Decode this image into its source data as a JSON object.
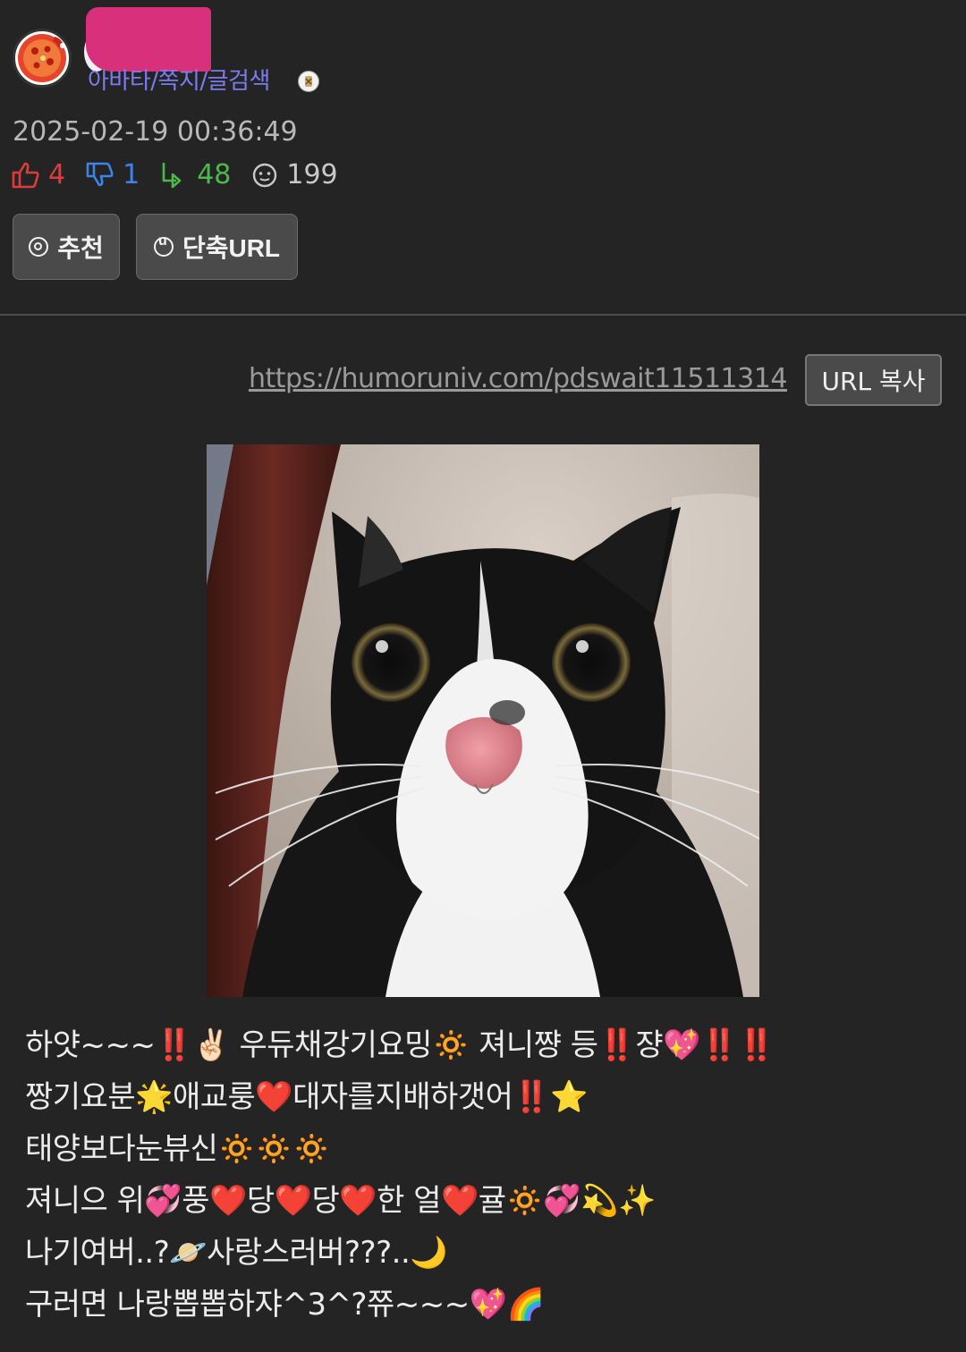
{
  "header": {
    "menu_link": "아바타/쪽지/글검색",
    "datetime": "2025-02-19 00:36:49"
  },
  "stats": {
    "upvotes": "4",
    "downvotes": "1",
    "replies": "48",
    "views": "199"
  },
  "actions": {
    "recommend_label": "추천",
    "short_url_label": "단축URL"
  },
  "share": {
    "url": "https://humoruniv.com/pdswait11511314",
    "copy_label": "URL 복사"
  },
  "post": {
    "lines": [
      "하얏~~~‼️✌🏻 우듀채강기요밍🔅 져니쨩 등‼️쟝💖‼️‼️",
      "짱기요분🌟애교룽❤️대자를지배하갯어‼️⭐",
      "태양보다눈뷰신🔅🔅🔅",
      "져니으 위💞풍❤️당❤️당❤️한 얼❤️귤🔅💞💫✨",
      "나기여버..?🪐사랑스러버???..🌙",
      "구러면 나랑뽑뽑하쟈^3^?쮸~~~💖🌈"
    ]
  },
  "colors": {
    "background": "#242424",
    "link": "#7a7cf0",
    "upvote": "#e03b3b",
    "downvote": "#3e84e8",
    "reply": "#4cb84c"
  }
}
